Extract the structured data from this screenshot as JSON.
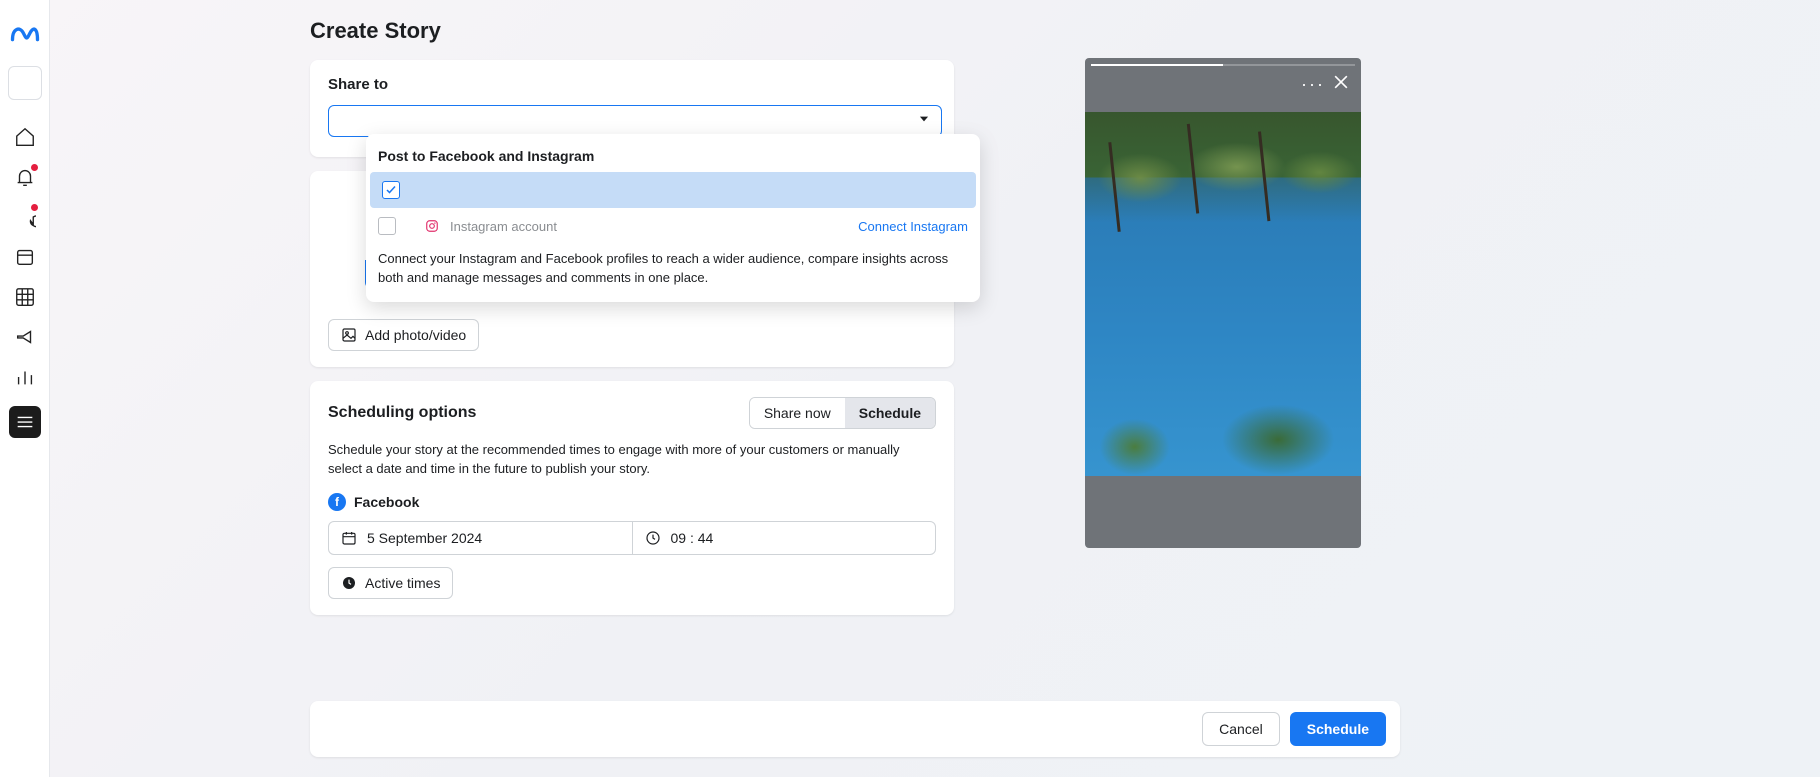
{
  "page": {
    "title": "Create Story"
  },
  "shareTo": {
    "label": "Share to",
    "dropdown": {
      "header": "Post to Facebook and Instagram",
      "instagramLabel": "Instagram account",
      "connectLink": "Connect Instagram",
      "description": "Connect your Instagram and Facebook profiles to reach a wider audience, compare insights across both and manage messages and comments in one place."
    }
  },
  "media": {
    "addButton": "Add photo/video"
  },
  "scheduling": {
    "title": "Scheduling options",
    "shareNow": "Share now",
    "schedule": "Schedule",
    "description": "Schedule your story at the recommended times to engage with more of your customers or manually select a date and time in the future to publish your story.",
    "facebookLabel": "Facebook",
    "date": "5 September 2024",
    "time": "09 : 44",
    "activeTimes": "Active times"
  },
  "footer": {
    "cancel": "Cancel",
    "schedule": "Schedule"
  },
  "preview": {
    "menu": "···"
  }
}
